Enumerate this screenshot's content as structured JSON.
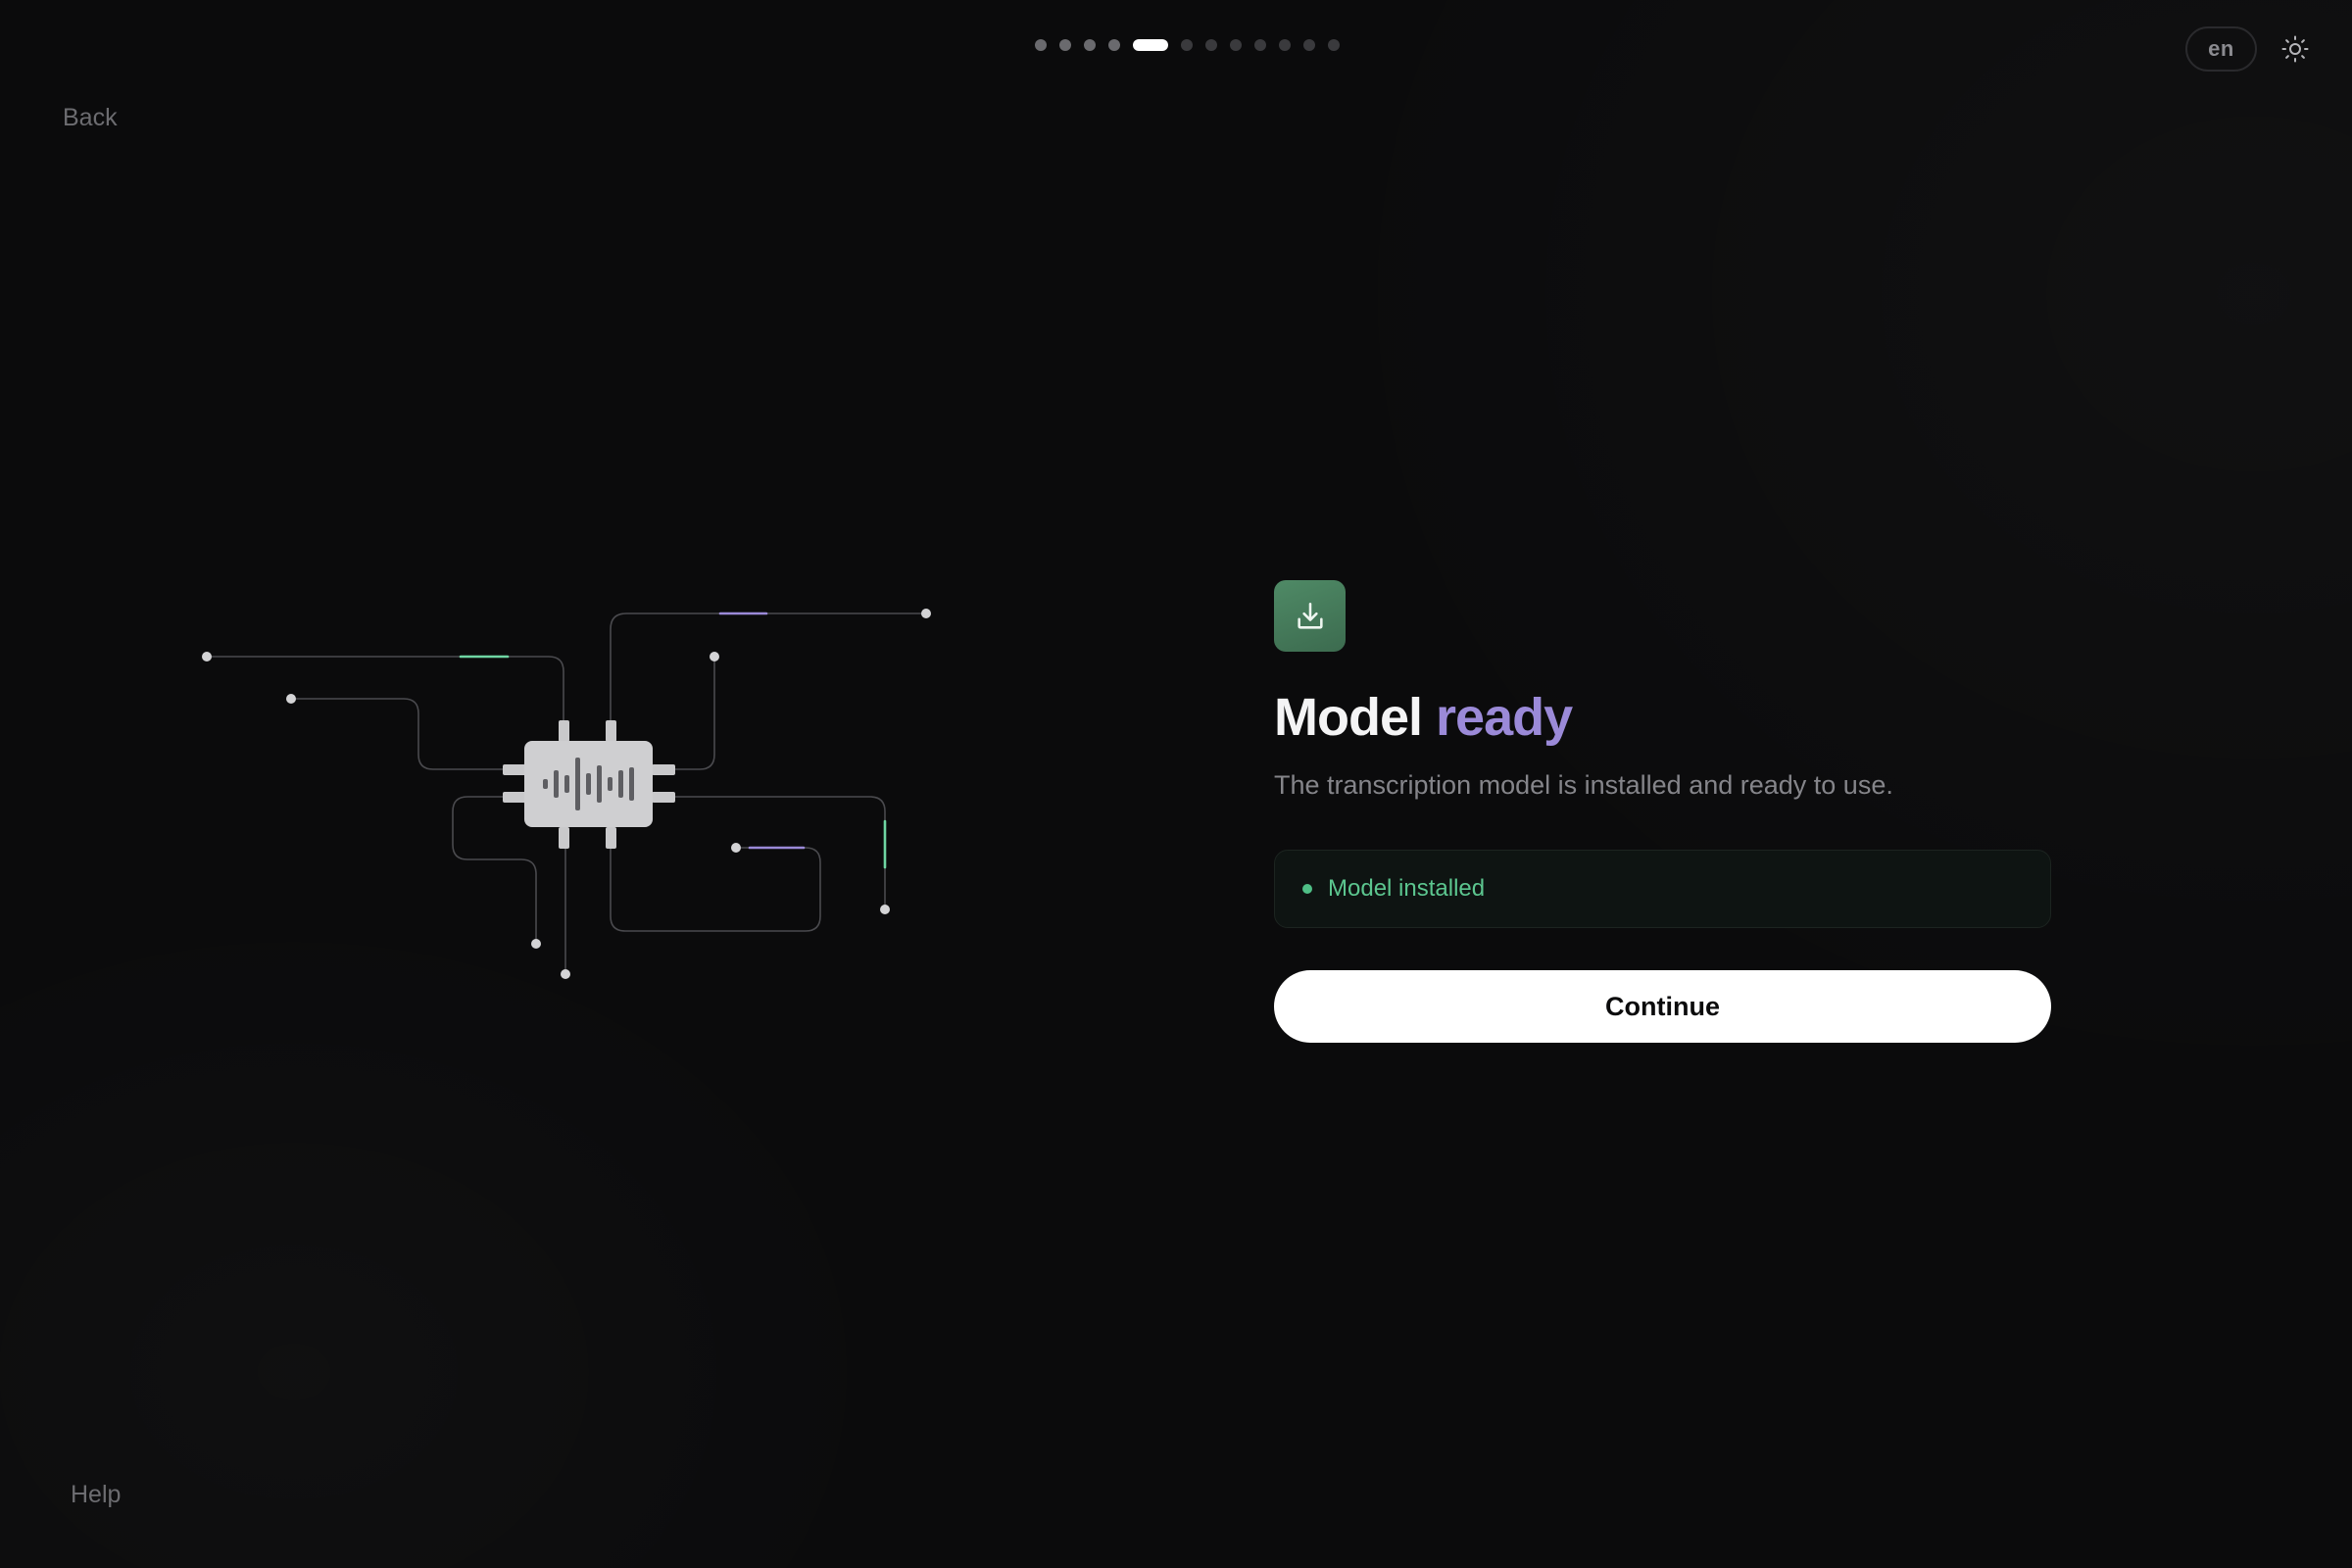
{
  "progress": {
    "total_steps": 12,
    "current_step": 5
  },
  "header": {
    "language": "en",
    "theme_icon": "sun-icon"
  },
  "nav": {
    "back_label": "Back",
    "help_label": "Help"
  },
  "illustration": {
    "chip_icon": "waveform-icon",
    "accent_colors": [
      "#6fd6a3",
      "#9b8ad8"
    ]
  },
  "main": {
    "icon": "download-icon",
    "title_part1": "Model",
    "title_part2": "ready",
    "subtitle": "The transcription model is installed and ready to use.",
    "status_text": "Model installed",
    "continue_label": "Continue"
  },
  "colors": {
    "background": "#0b0b0c",
    "accent_purple": "#9b8ad8",
    "accent_green": "#4f8a66",
    "status_green": "#5cc68f"
  }
}
